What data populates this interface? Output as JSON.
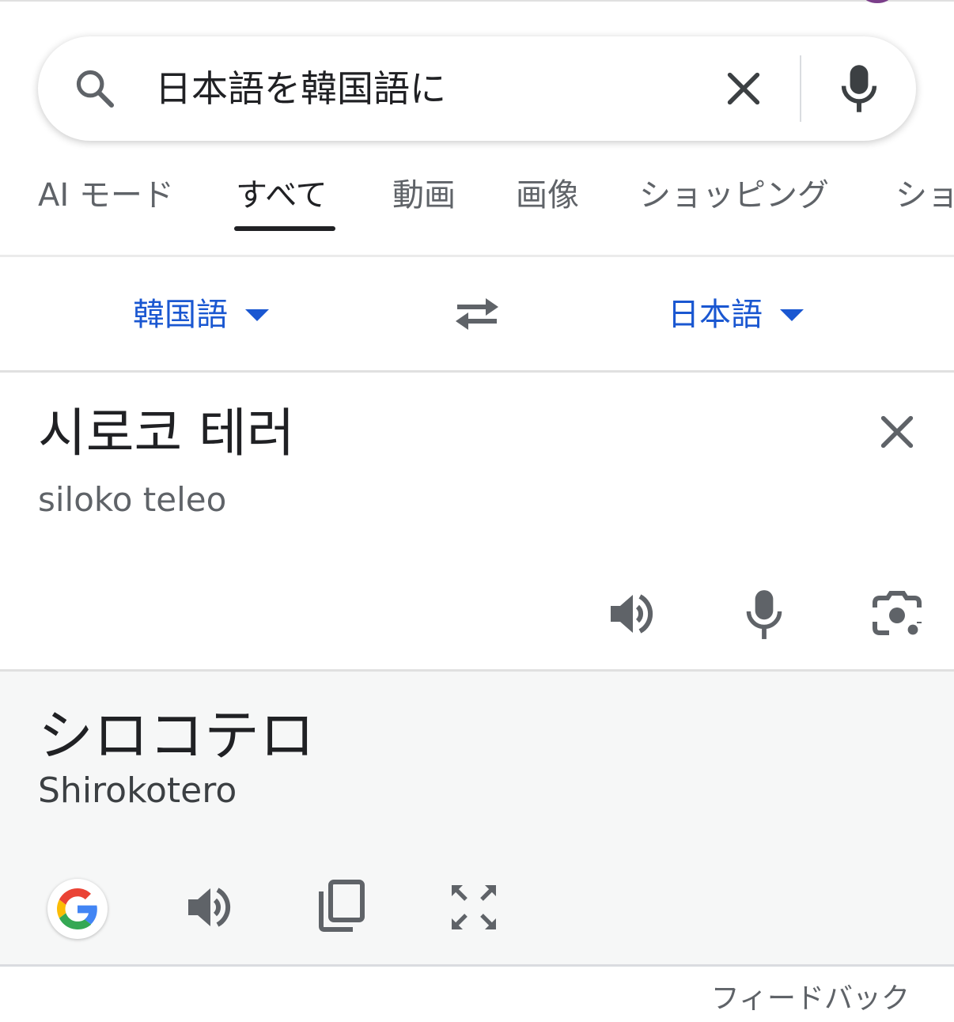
{
  "search": {
    "query": "日本語を韓国語に"
  },
  "tabs": [
    {
      "label": "AI モード",
      "active": false
    },
    {
      "label": "すべて",
      "active": true
    },
    {
      "label": "動画",
      "active": false
    },
    {
      "label": "画像",
      "active": false
    },
    {
      "label": "ショッピング",
      "active": false
    },
    {
      "label": "ショ",
      "active": false
    }
  ],
  "translator": {
    "source_language": "韓国語",
    "target_language": "日本語",
    "source_text": "시로코 테러",
    "source_romanization": "siloko teleo",
    "translation": "シロコテロ",
    "translation_romanization": "Shirokotero",
    "link_color": "#1a57d1"
  },
  "icons": {
    "search": "search-icon",
    "clear": "close-icon",
    "mic": "microphone-icon",
    "swap": "swap-arrows-icon",
    "speak": "speaker-icon",
    "camera": "lens-camera-icon",
    "google": "google-g-logo",
    "copy": "copy-icon",
    "expand": "fullscreen-icon"
  },
  "footer": {
    "feedback_label": "フィードバック"
  }
}
